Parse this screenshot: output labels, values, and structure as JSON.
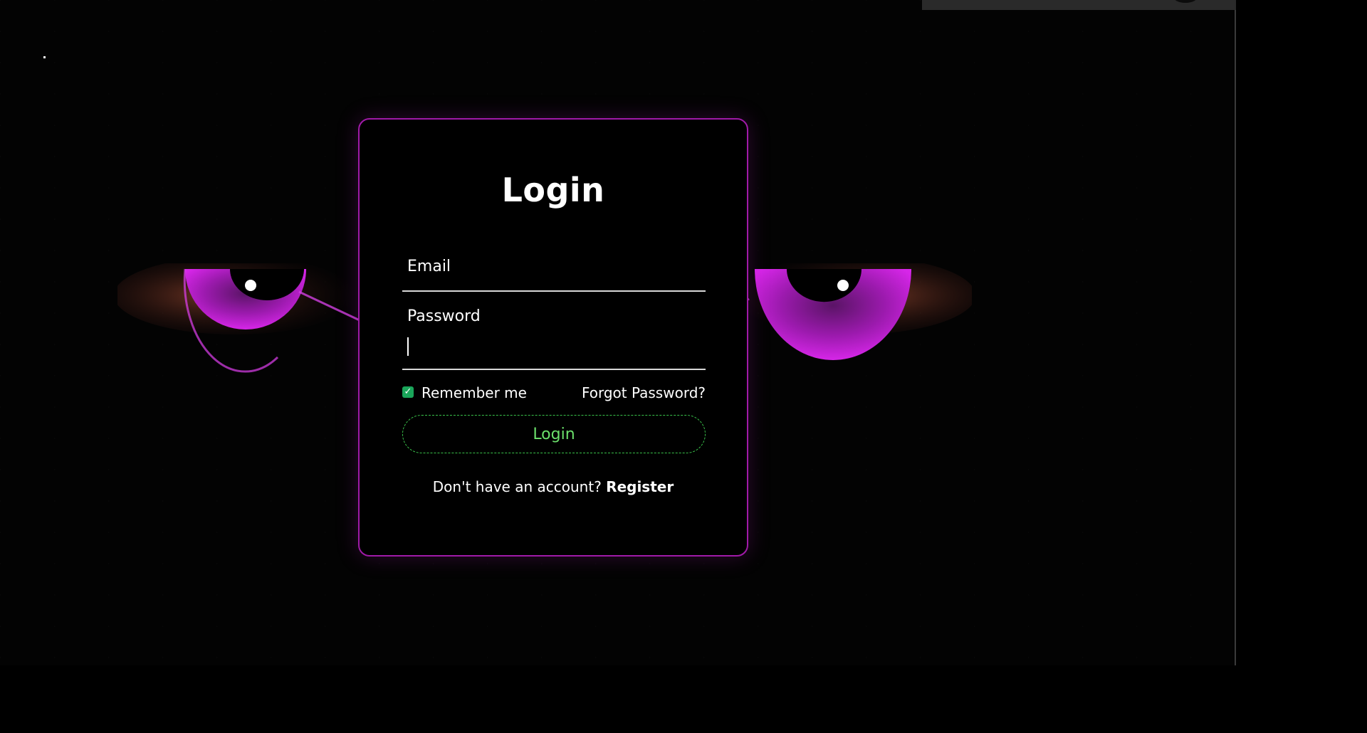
{
  "login_card": {
    "title": "Login",
    "email_label": "Email",
    "email_value": "",
    "password_label": "Password",
    "password_value": "",
    "remember_label": "Remember me",
    "remember_checked": true,
    "forgot_label": "Forgot Password?",
    "submit_label": "Login",
    "register_prompt": "Don't have an account?",
    "register_label": "Register"
  },
  "colors": {
    "background": "#000000",
    "card_border": "#a01aa8",
    "eye_iris": "#c21fd6",
    "button_border": "#39c24a",
    "button_text": "#6be06b",
    "checkbox": "#1aa55a"
  },
  "icons": {
    "checkbox": "checkmark-icon",
    "left_eye": "eye-illustration-left",
    "right_eye": "eye-illustration-right"
  }
}
